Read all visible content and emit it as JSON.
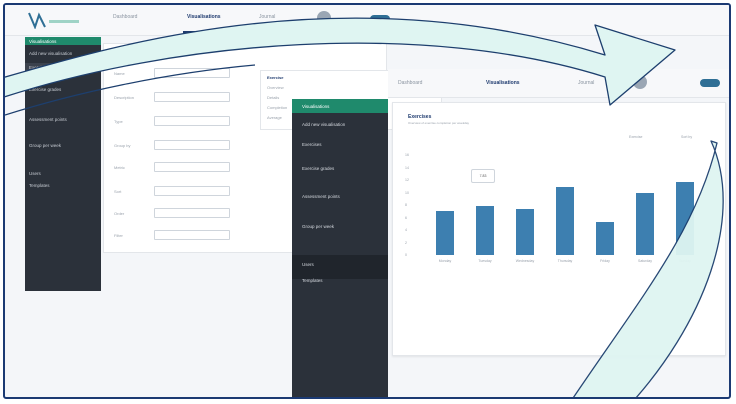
{
  "back": {
    "nav": [
      {
        "label": "Dashboard"
      },
      {
        "label": "Visualisations"
      },
      {
        "label": "Journal"
      }
    ],
    "sidebar": {
      "header": "Visualisations",
      "items": [
        {
          "label": "Add new visualisation"
        },
        {
          "label": "Exercises"
        },
        {
          "label": "Exercise grades"
        },
        {
          "label": "Assessment points"
        },
        {
          "label": "Group per week"
        },
        {
          "label": "Users"
        },
        {
          "label": "Templates"
        }
      ]
    },
    "form": {
      "title": "Settings",
      "labels": [
        "Name",
        "Description",
        "Type",
        "Group by",
        "Metric",
        "Sort",
        "Order",
        "Filter",
        "Size"
      ]
    },
    "mid": {
      "title": "Exercise",
      "lines": [
        "Overview",
        "Details",
        "Completion",
        "Average"
      ]
    }
  },
  "front": {
    "nav": [
      {
        "label": "Dashboard"
      },
      {
        "label": "Visualisations"
      },
      {
        "label": "Journal"
      }
    ],
    "sidebar": {
      "header": "Visualisations",
      "items": [
        {
          "label": "Add new visualisation"
        },
        {
          "label": "Exercises"
        },
        {
          "label": "Exercise grades"
        },
        {
          "label": "Assessment points"
        },
        {
          "label": "Group per week"
        }
      ],
      "footer": [
        {
          "label": "Users"
        },
        {
          "label": "Templates"
        }
      ]
    },
    "card": {
      "title": "Exercises",
      "subtitle": "Overview of exercise completion per weekday",
      "filter_label": "Exercise",
      "sort_label": "Sort by"
    }
  },
  "tooltip": "7.83",
  "chart_data": {
    "type": "bar",
    "categories": [
      "Monday",
      "Tuesday",
      "Wednesday",
      "Thursday",
      "Friday",
      "Saturday",
      "Sunday"
    ],
    "values": [
      7.1,
      7.8,
      7.4,
      10.9,
      5.3,
      10.0,
      11.7
    ],
    "ylim": [
      0,
      16
    ],
    "yticks": [
      0,
      2,
      4,
      6,
      8,
      10,
      12,
      14,
      16
    ],
    "grid": false,
    "color": "#3d7fb0"
  },
  "colors": {
    "arrow_fill": "#dff5f2",
    "arrow_stroke": "#1d3f6e",
    "sidebar_bg": "#2b313a",
    "accent_green": "#1f8a6c",
    "brand_blue": "#1f3b6f"
  }
}
